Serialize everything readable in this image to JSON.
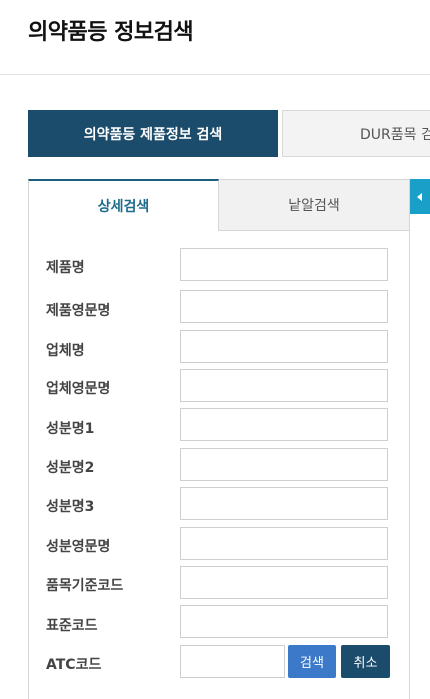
{
  "page": {
    "title": "의약품등 정보검색"
  },
  "main_tabs": [
    {
      "label": "의약품등 제품정보 검색",
      "active": true
    },
    {
      "label": "DUR품목 검",
      "active": false
    }
  ],
  "sub_tabs": [
    {
      "label": "상세검색",
      "active": true
    },
    {
      "label": "낱알검색",
      "active": false
    }
  ],
  "side_toggle": {
    "icon": "caret-left-icon",
    "color": "#1aa0c8"
  },
  "form": {
    "fields": [
      {
        "label": "제품명",
        "value": ""
      },
      {
        "label": "제품영문명",
        "value": ""
      },
      {
        "label": "업체명",
        "value": ""
      },
      {
        "label": "업체영문명",
        "value": ""
      },
      {
        "label": "성분명1",
        "value": ""
      },
      {
        "label": "성분명2",
        "value": ""
      },
      {
        "label": "성분명3",
        "value": ""
      },
      {
        "label": "성분영문명",
        "value": ""
      },
      {
        "label": "품목기준코드",
        "value": ""
      },
      {
        "label": "표준코드",
        "value": ""
      },
      {
        "label": "ATC코드",
        "value": ""
      }
    ],
    "search_button": "검색",
    "cancel_button": "취소"
  },
  "colors": {
    "active_tab": "#1c4c6c",
    "active_subtab_text": "#1d6c8c",
    "search_button": "#3c79c8",
    "cancel_button": "#1c4c6c"
  }
}
